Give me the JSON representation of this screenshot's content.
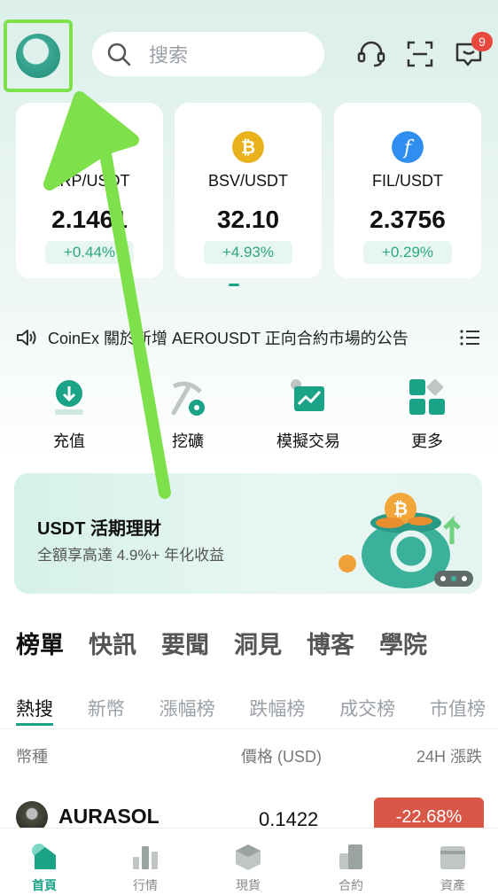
{
  "header": {
    "search_placeholder": "搜索",
    "message_count": "9",
    "icons": [
      "headset-icon",
      "scan-icon",
      "message-icon"
    ]
  },
  "tickers": [
    {
      "pair": "XRP/USDT",
      "price": "2.1461",
      "change": "+0.44%",
      "icon": "xrp-icon"
    },
    {
      "pair": "BSV/USDT",
      "price": "32.10",
      "change": "+4.93%",
      "icon": "bsv-icon"
    },
    {
      "pair": "FIL/USDT",
      "price": "2.3756",
      "change": "+0.29%",
      "icon": "fil-icon"
    }
  ],
  "announcement": {
    "text": "CoinEx 關於新增 AEROUSDT 正向合約市場的公告"
  },
  "quick_actions": [
    {
      "label": "充值"
    },
    {
      "label": "挖礦"
    },
    {
      "label": "模擬交易"
    },
    {
      "label": "更多"
    }
  ],
  "banner": {
    "title": "USDT 活期理財",
    "subtitle": "全額享高達 4.9%+ 年化收益"
  },
  "content_tabs": [
    "榜單",
    "快訊",
    "要聞",
    "洞見",
    "博客",
    "學院"
  ],
  "sub_tabs": [
    "熱搜",
    "新幣",
    "漲幅榜",
    "跌幅榜",
    "成交榜",
    "市值榜"
  ],
  "table": {
    "headers": [
      "幣種",
      "價格 (USD)",
      "24H 漲跌"
    ],
    "rows": [
      {
        "name": "AURASOL",
        "price": "0.1422",
        "change": "-22.68%"
      }
    ]
  },
  "bottom_nav": [
    {
      "label": "首頁",
      "active": true
    },
    {
      "label": "行情",
      "active": false
    },
    {
      "label": "現貨",
      "active": false
    },
    {
      "label": "合約",
      "active": false
    },
    {
      "label": "資產",
      "active": false
    }
  ],
  "colors": {
    "accent": "#1aa387",
    "up": "#2da77c",
    "down": "#d85747",
    "highlight": "#7ee04a"
  }
}
